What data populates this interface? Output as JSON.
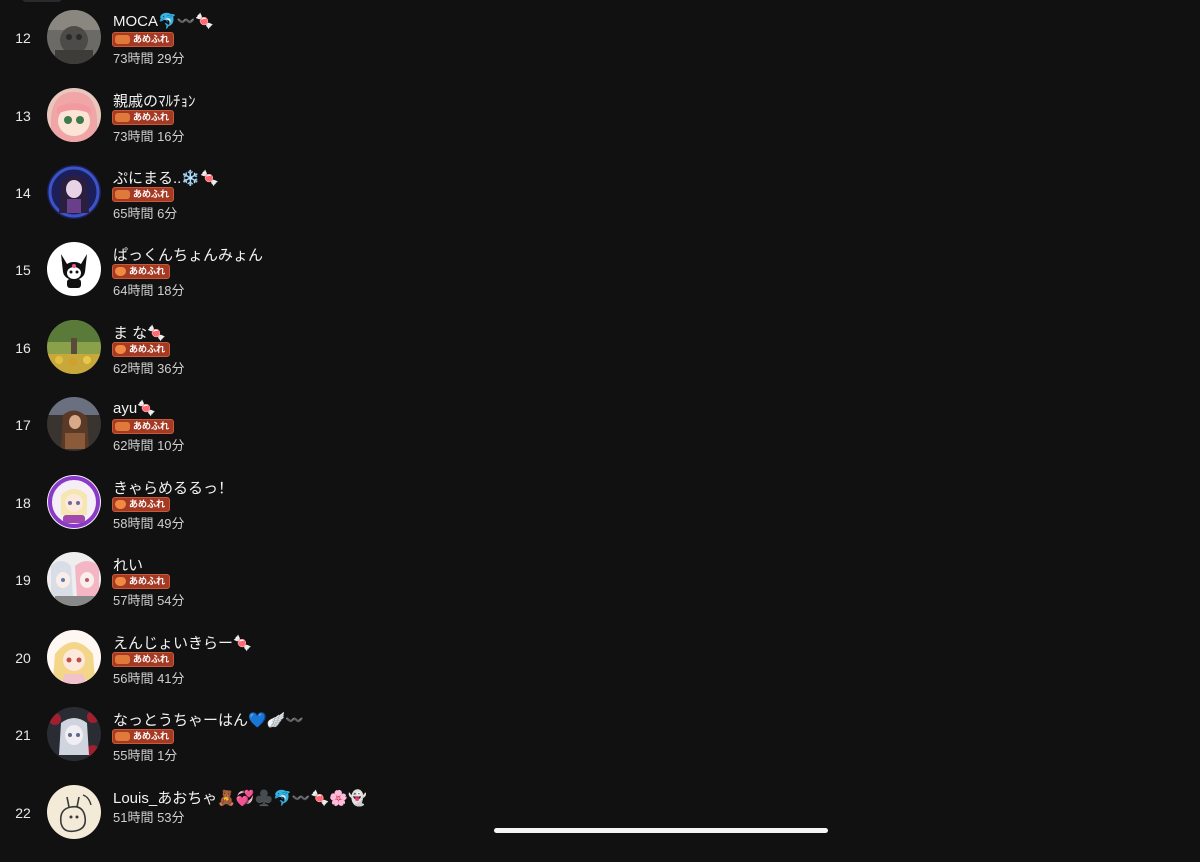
{
  "rows": [
    {
      "rank": "12",
      "name": "MOCA🐬〰️🍬",
      "badge": "あめふれ",
      "time": "73時間 29分",
      "avatar": "avatar-photo-cat"
    },
    {
      "rank": "13",
      "name": "親戚のﾏﾙﾁｮﾝ",
      "badge": "あめふれ",
      "time": "73時間 16分",
      "avatar": "avatar-anime-pink"
    },
    {
      "rank": "14",
      "name": "ぷにまる..❄️🍬",
      "badge": "あめふれ",
      "time": "65時間 6分",
      "avatar": "avatar-anime-dark"
    },
    {
      "rank": "15",
      "name": "ぱっくんちょんみょん",
      "badge": "あめふれ",
      "time": "64時間 18分",
      "avatar": "avatar-kuromi"
    },
    {
      "rank": "16",
      "name": "ま な🍬",
      "badge": "あめふれ",
      "time": "62時間 36分",
      "avatar": "avatar-park"
    },
    {
      "rank": "17",
      "name": "ayu🍬",
      "badge": "あめふれ",
      "time": "62時間 10分",
      "avatar": "avatar-photo-girl"
    },
    {
      "rank": "18",
      "name": "きゃらめるるっ！",
      "badge": "あめふれ",
      "time": "58時間 49分",
      "avatar": "avatar-anime-frame"
    },
    {
      "rank": "19",
      "name": "れい",
      "badge": "あめふれ",
      "time": "57時間 54分",
      "avatar": "avatar-anime-pair"
    },
    {
      "rank": "20",
      "name": "えんじょいきらー🍬",
      "badge": "あめふれ",
      "time": "56時間 41分",
      "avatar": "avatar-anime-blonde"
    },
    {
      "rank": "21",
      "name": "なっとうちゃーはん💙🪽〰️",
      "badge": "あめふれ",
      "time": "55時間 1分",
      "avatar": "avatar-anime-roses"
    },
    {
      "rank": "22",
      "name": "Louis_あおちゃ🧸💞♣️🐬〰️🍬🌸👻",
      "badge": "",
      "time": "51時間 53分",
      "avatar": "avatar-sketch"
    }
  ]
}
